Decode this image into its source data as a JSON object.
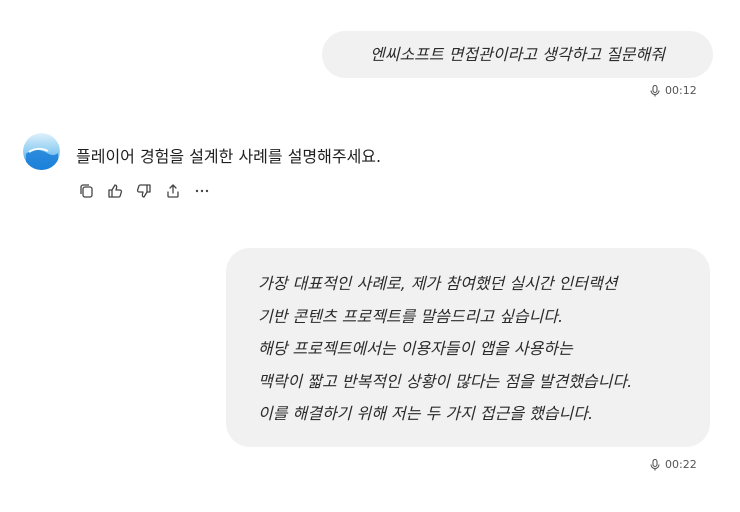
{
  "messages": {
    "user_1": {
      "text": "엔씨소프트 면접관이라고 생각하고 질문해줘",
      "duration": "00:12"
    },
    "assistant_1": {
      "text": "플레이어 경험을 설계한 사례를 설명해주세요."
    },
    "user_2": {
      "lines": [
        "가장 대표적인 사례로, 제가 참여했던 실시간 인터랙션",
        "기반 콘텐츠 프로젝트를 말씀드리고 싶습니다.",
        "해당 프로젝트에서는 이용자들이 앱을 사용하는",
        "맥락이 짧고 반복적인 상황이 많다는 점을 발견했습니다.",
        "이를 해결하기 위해 저는 두 가지 접근을 했습니다."
      ],
      "duration": "00:22"
    }
  },
  "actions": [
    "copy-icon",
    "thumbs-up-icon",
    "thumbs-down-icon",
    "share-icon",
    "more-icon"
  ],
  "colors": {
    "bubble": "#f1f1f1",
    "avatar_top": "#bfe3f7",
    "avatar_bottom": "#1e88e5"
  }
}
